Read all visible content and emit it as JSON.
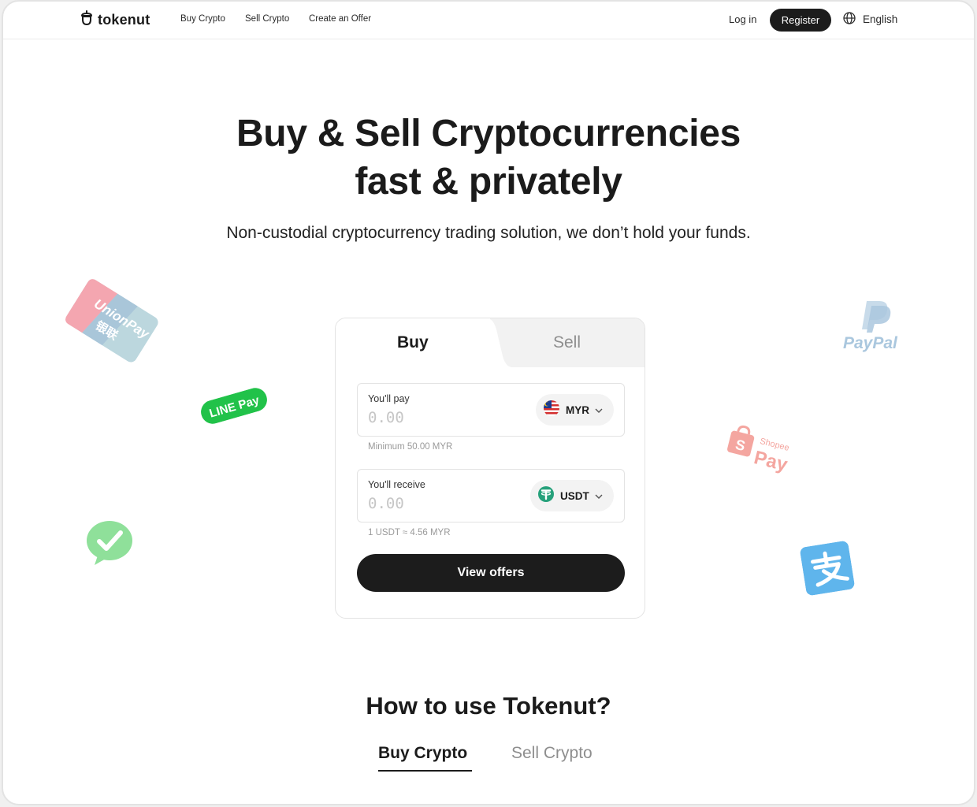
{
  "nav": {
    "brand": "tokenut",
    "links": [
      "Buy Crypto",
      "Sell Crypto",
      "Create an Offer"
    ],
    "login": "Log in",
    "register": "Register",
    "language": "English"
  },
  "hero": {
    "title_line1": "Buy & Sell Cryptocurrencies",
    "title_line2": "fast & privately",
    "subtitle": "Non-custodial cryptocurrency trading solution, we don’t hold your funds."
  },
  "trade_card": {
    "tabs": [
      "Buy",
      "Sell"
    ],
    "active_tab": "Buy",
    "pay": {
      "label": "You'll pay",
      "placeholder": "0.00",
      "currency": "MYR",
      "hint": "Minimum 50.00 MYR"
    },
    "receive": {
      "label": "You'll receive",
      "placeholder": "0.00",
      "currency": "USDT",
      "hint": "1 USDT ≈ 4.56 MYR"
    },
    "cta": "View offers"
  },
  "payment_logos": {
    "unionpay": {
      "text": "UnionPay",
      "subtext": "银联"
    },
    "linepay": "LINE Pay",
    "paypal": "PayPal",
    "shopeepay": {
      "small": "Shopee",
      "big": "Pay"
    },
    "wechat": "wechat-pay-icon",
    "alipay": "alipay-icon"
  },
  "how_to": {
    "title": "How to use Tokenut?",
    "tabs": [
      "Buy Crypto",
      "Sell Crypto"
    ],
    "active_tab": "Buy Crypto"
  },
  "colors": {
    "primary": "#1c1c1c",
    "linepay": "#21c249",
    "wechat": "#8fe09a",
    "alipay": "#5fb5ec",
    "paypal": "#aac7de",
    "shopee": "#f4a6a0",
    "usdt": "#26a17b"
  }
}
